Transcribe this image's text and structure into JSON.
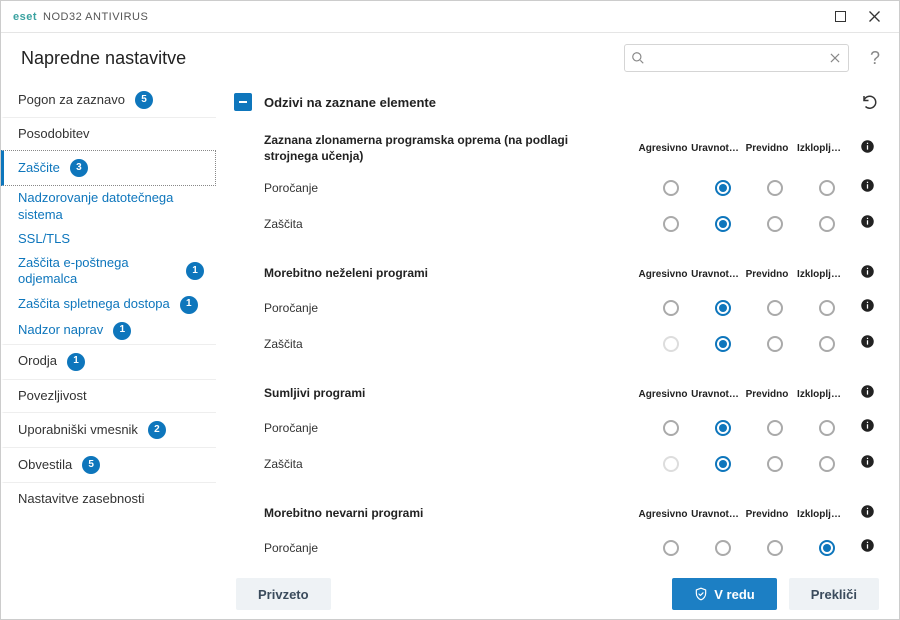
{
  "titlebar": {
    "brand": "eset",
    "product": "NOD32 ANTIVIRUS"
  },
  "header": {
    "title": "Napredne nastavitve",
    "search_placeholder": "",
    "help": "?"
  },
  "sidebar": [
    {
      "id": "engine",
      "label": "Pogon za zaznavo",
      "badge": "5",
      "kind": "top"
    },
    {
      "id": "update",
      "label": "Posodobitev",
      "kind": "top"
    },
    {
      "id": "protections",
      "label": "Zaščite",
      "badge": "3",
      "kind": "top",
      "selected": true
    },
    {
      "id": "fsmon",
      "label": "Nadzorovanje datotečnega sistema",
      "kind": "sub"
    },
    {
      "id": "ssltls",
      "label": "SSL/TLS",
      "kind": "sub"
    },
    {
      "id": "email",
      "label": "Zaščita e-poštnega odjemalca",
      "badge": "1",
      "kind": "sub"
    },
    {
      "id": "web",
      "label": "Zaščita spletnega dostopa",
      "badge": "1",
      "kind": "sub"
    },
    {
      "id": "dev",
      "label": "Nadzor naprav",
      "badge": "1",
      "kind": "sub"
    },
    {
      "id": "tools",
      "label": "Orodja",
      "badge": "1",
      "kind": "top"
    },
    {
      "id": "conn",
      "label": "Povezljivost",
      "kind": "top"
    },
    {
      "id": "ui",
      "label": "Uporabniški vmesnik",
      "badge": "2",
      "kind": "top"
    },
    {
      "id": "notif",
      "label": "Obvestila",
      "badge": "5",
      "kind": "top"
    },
    {
      "id": "privacy",
      "label": "Nastavitve zasebnosti",
      "kind": "top"
    }
  ],
  "section": {
    "title": "Odzivi na zaznane elemente",
    "columns": [
      "Agresivno",
      "Uravnot…",
      "Previdno",
      "Izkloplj…"
    ]
  },
  "groups": [
    {
      "title": "Zaznana zlonamerna programska oprema (na podlagi strojnega učenja)",
      "rows": [
        {
          "label": "Poročanje",
          "sel": 1,
          "disabled": []
        },
        {
          "label": "Zaščita",
          "sel": 1,
          "disabled": []
        }
      ]
    },
    {
      "title": "Morebitno neželeni programi",
      "rows": [
        {
          "label": "Poročanje",
          "sel": 1,
          "disabled": []
        },
        {
          "label": "Zaščita",
          "sel": 1,
          "disabled": [
            0
          ]
        }
      ]
    },
    {
      "title": "Sumljivi programi",
      "rows": [
        {
          "label": "Poročanje",
          "sel": 1,
          "disabled": []
        },
        {
          "label": "Zaščita",
          "sel": 1,
          "disabled": [
            0
          ]
        }
      ]
    },
    {
      "title": "Morebitno nevarni programi",
      "rows": [
        {
          "label": "Poročanje",
          "sel": 3,
          "disabled": []
        }
      ]
    }
  ],
  "footer": {
    "default_btn": "Privzeto",
    "ok_btn": "V redu",
    "cancel_btn": "Prekliči"
  }
}
